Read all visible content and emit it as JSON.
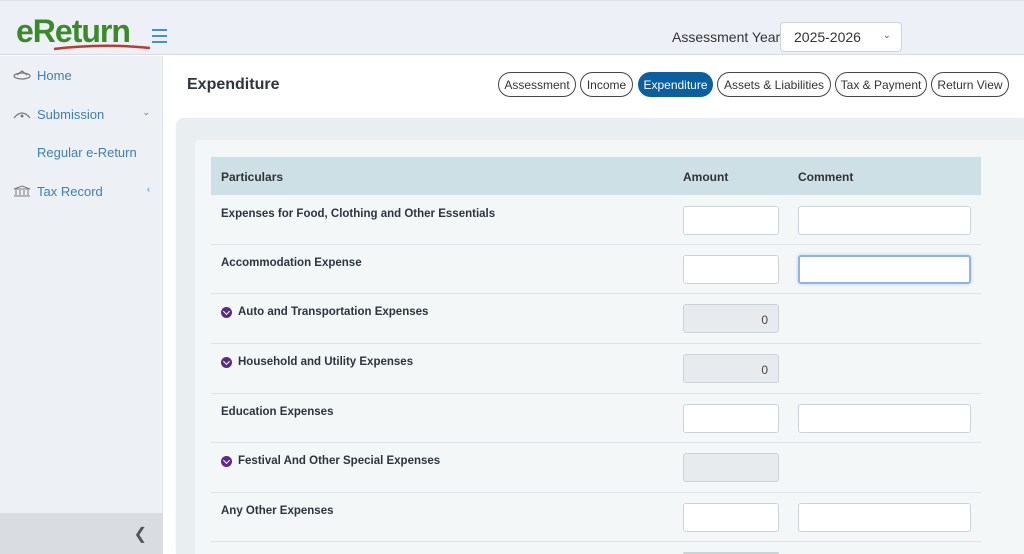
{
  "header": {
    "logo_text": "eReturn",
    "assessment_year_label": "Assessment Year",
    "assessment_year_value": "2025-2026"
  },
  "sidebar": {
    "items": [
      {
        "label": "Home",
        "icon": "home-icon"
      },
      {
        "label": "Submission",
        "icon": "submission-icon"
      },
      {
        "label": "Regular e-Return",
        "icon": ""
      },
      {
        "label": "Tax Record",
        "icon": "bank-icon"
      }
    ]
  },
  "page": {
    "title": "Expenditure"
  },
  "tabs": [
    {
      "label": "Assessment"
    },
    {
      "label": "Income"
    },
    {
      "label": "Expenditure",
      "active": true
    },
    {
      "label": "Assets & Liabilities"
    },
    {
      "label": "Tax & Payment"
    },
    {
      "label": "Return View"
    }
  ],
  "table": {
    "headers": [
      "Particulars",
      "Amount",
      "Comment"
    ],
    "rows": [
      {
        "name": "Expenses for Food, Clothing and Other Essentials",
        "amount": "",
        "expandable": false
      },
      {
        "name": "Accommodation Expense",
        "amount": "",
        "expandable": false
      },
      {
        "name": "Auto and Transportation Expenses",
        "amount": "0",
        "expandable": true
      },
      {
        "name": "Household and Utility Expenses",
        "amount": "0",
        "expandable": true
      },
      {
        "name": "Education Expenses",
        "amount": "",
        "expandable": false
      },
      {
        "name": "Festival And Other Special Expenses",
        "amount": "",
        "expandable": true
      },
      {
        "name": "Any Other Expenses",
        "amount": "",
        "expandable": false
      }
    ]
  },
  "colors": {
    "accent": "#0b5f9e",
    "logo_green": "#3a8a2a",
    "sidebar_link": "#3d7fb5"
  }
}
